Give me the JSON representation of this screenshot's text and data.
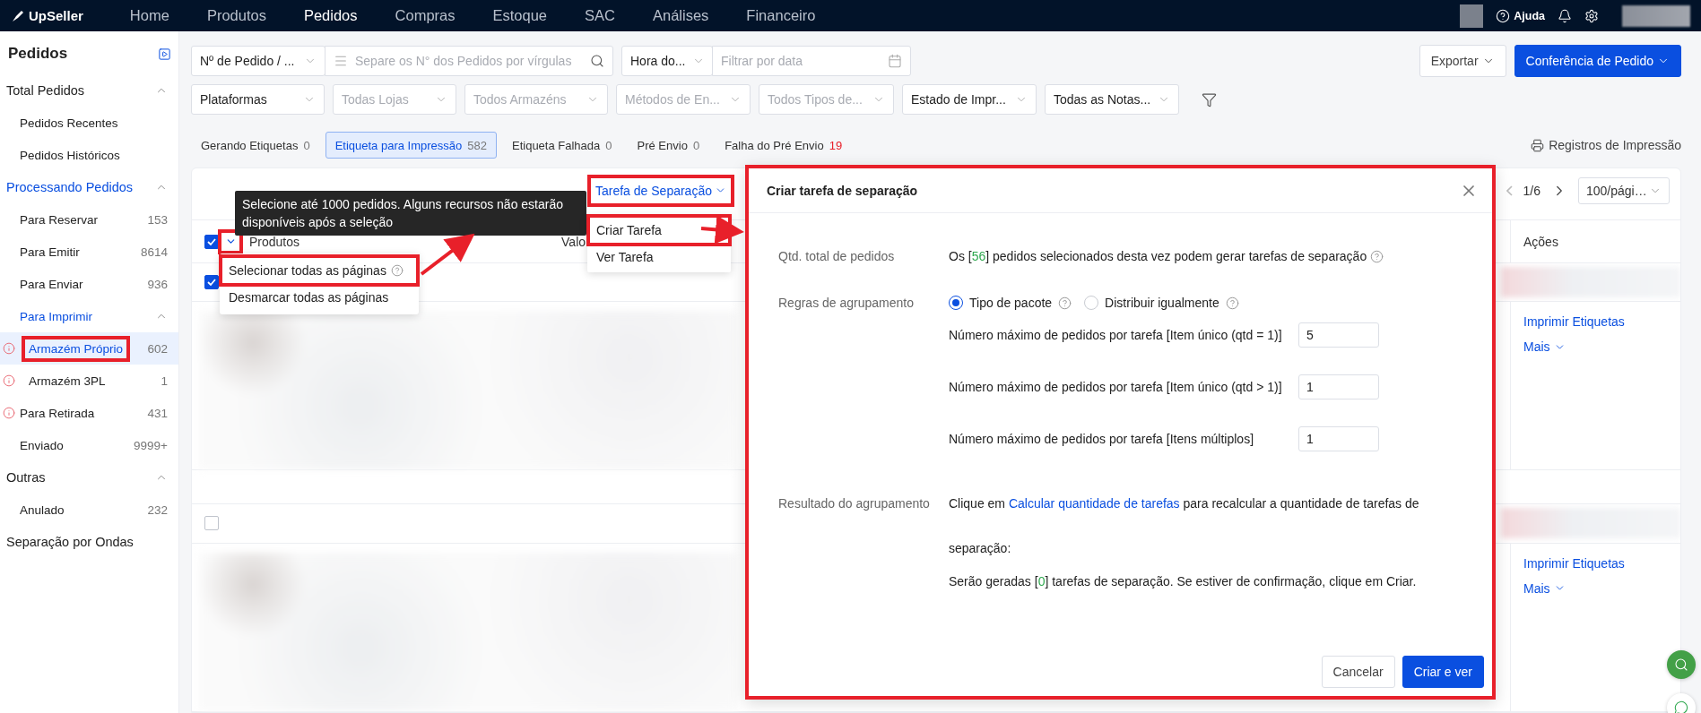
{
  "top_nav": {
    "logo": "UpSeller",
    "items": [
      {
        "label": "Home",
        "selected": false
      },
      {
        "label": "Produtos",
        "selected": false
      },
      {
        "label": "Pedidos",
        "selected": true
      },
      {
        "label": "Compras",
        "selected": false
      },
      {
        "label": "Estoque",
        "selected": false
      },
      {
        "label": "SAC",
        "selected": false
      },
      {
        "label": "Análises",
        "selected": false
      },
      {
        "label": "Financeiro",
        "selected": false
      }
    ],
    "help": "Ajuda"
  },
  "sidebar": {
    "title": "Pedidos",
    "groups": [
      {
        "label": "Total Pedidos",
        "selected": false,
        "children": [
          {
            "label": "Pedidos Recentes",
            "selected": false,
            "warning": false,
            "highlighted": false
          },
          {
            "label": "Pedidos Históricos",
            "selected": false,
            "warning": false,
            "highlighted": false
          }
        ]
      },
      {
        "label": "Processando Pedidos",
        "selected": true,
        "children": [
          {
            "label": "Para Reservar",
            "count": "153",
            "selected": false,
            "warning": false,
            "highlighted": false
          },
          {
            "label": "Para Emitir",
            "count": "8614",
            "selected": false,
            "warning": false,
            "highlighted": false
          },
          {
            "label": "Para Enviar",
            "count": "936",
            "selected": false,
            "warning": false,
            "highlighted": false
          },
          {
            "label": "Para Imprimir",
            "selected": true,
            "warning": false,
            "highlighted": false,
            "children": [
              {
                "label": "Armazém Próprio",
                "count": "602",
                "selected": true,
                "warning": true,
                "highlighted": true
              },
              {
                "label": "Armazém 3PL",
                "count": "1",
                "selected": false,
                "warning": true,
                "highlighted": false
              }
            ]
          },
          {
            "label": "Para Retirada",
            "count": "431",
            "selected": false,
            "warning": true,
            "highlighted": false
          },
          {
            "label": "Enviado",
            "count": "9999+",
            "selected": false,
            "warning": false,
            "highlighted": false
          }
        ]
      },
      {
        "label": "Outras",
        "selected": false,
        "children": [
          {
            "label": "Anulado",
            "count": "232",
            "selected": false,
            "warning": false,
            "highlighted": false
          }
        ]
      },
      {
        "label": "Separação por Ondas",
        "selected": false
      }
    ]
  },
  "filters": {
    "row_1": [
      {
        "kind": "select",
        "value": "Nº de Pedido / ..."
      },
      {
        "kind": "search",
        "placeholder": "Separe os N° dos Pedidos por vírgulas"
      },
      {
        "kind": "select",
        "value": "Hora do..."
      },
      {
        "kind": "date",
        "placeholder": "Filtrar por data"
      }
    ],
    "row_2": [
      {
        "value": "Plataformas"
      },
      {
        "placeholder": "Todas Lojas"
      },
      {
        "placeholder": "Todos Armazéns"
      },
      {
        "placeholder": "Métodos de En..."
      },
      {
        "placeholder": "Todos Tipos de..."
      },
      {
        "value": "Estado de Impr..."
      },
      {
        "value": "Todas as Notas..."
      }
    ],
    "export": "Exportar",
    "primary": "Conferência de Pedido"
  },
  "tabs": [
    {
      "label": "Gerando Etiquetas",
      "count": "0",
      "selected": false,
      "alert": false
    },
    {
      "label": "Etiqueta para Impressão",
      "count": "582",
      "selected": true,
      "alert": false
    },
    {
      "label": "Etiqueta Falhada",
      "count": "0",
      "selected": false,
      "alert": false
    },
    {
      "label": "Pré Envio",
      "count": "0",
      "selected": false,
      "alert": false
    },
    {
      "label": "Falha do Pré Envio",
      "count": "19",
      "selected": false,
      "alert": true
    }
  ],
  "print_log": "Registros de Impressão",
  "table": {
    "toolbar": {
      "picking_task": {
        "label": "Tarefa de Separação",
        "highlighted": true
      },
      "page": "1/6",
      "page_size": "100/pági…"
    },
    "header": {
      "checked": true,
      "chevron_highlighted": true,
      "columns": [
        "Produtos",
        "Valo",
        "Ações"
      ]
    },
    "rows": [
      {
        "checked": true,
        "actions": [
          "Imprimir Etiquetas",
          "Mais"
        ]
      },
      {
        "checked": false,
        "actions": [
          "Imprimir Etiquetas",
          "Mais"
        ]
      }
    ]
  },
  "tooltip": "Selecione até 1000 pedidos. Alguns recursos não estarão disponíveis após a seleção",
  "select_menu": [
    {
      "label": "Selecionar todas as páginas",
      "help": true,
      "highlighted": true
    },
    {
      "label": "Desmarcar todas as páginas",
      "help": false,
      "highlighted": false
    }
  ],
  "task_menu": [
    {
      "label": "Criar Tarefa",
      "highlighted": true
    },
    {
      "label": "Ver Tarefa",
      "highlighted": false
    }
  ],
  "modal": {
    "title": "Criar tarefa de separação",
    "highlighted": true,
    "total": {
      "label": "Qtd. total de pedidos",
      "before": "Os [",
      "count": "56",
      "after": "] pedidos selecionados desta vez podem gerar tarefas de separação"
    },
    "rules": {
      "label": "Regras de agrupamento",
      "options": [
        {
          "label": "Tipo de pacote",
          "selected": true
        },
        {
          "label": "Distribuir igualmente",
          "selected": false
        }
      ],
      "limits": [
        {
          "label": "Número máximo de pedidos por tarefa [Item único (qtd = 1)]",
          "value": "5"
        },
        {
          "label": "Número máximo de pedidos por tarefa [Item único (qtd > 1)]",
          "value": "1"
        },
        {
          "label": "Número máximo de pedidos por tarefa [Itens múltiplos]",
          "value": "1"
        }
      ]
    },
    "result": {
      "label": "Resultado do agrupamento",
      "before": "Clique em ",
      "link": "Calcular quantidade de tarefas",
      "after": " para recalcular a quantidade de tarefas de separação:",
      "line_2_before": "Serão geradas [",
      "line_2_count": "0",
      "line_2_after": "] tarefas de separação. Se estiver de confirmação, clique em Criar."
    },
    "cancel": "Cancelar",
    "confirm": "Criar e ver"
  }
}
